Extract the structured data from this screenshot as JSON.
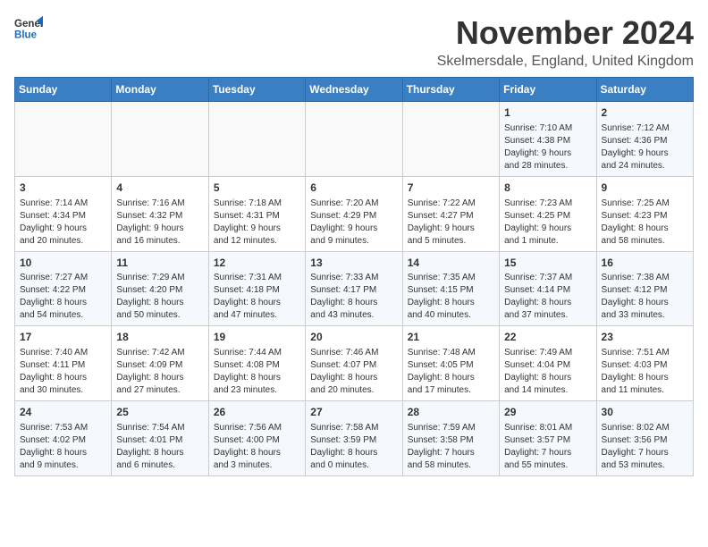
{
  "logo": {
    "line1": "General",
    "line2": "Blue"
  },
  "title": "November 2024",
  "location": "Skelmersdale, England, United Kingdom",
  "days_of_week": [
    "Sunday",
    "Monday",
    "Tuesday",
    "Wednesday",
    "Thursday",
    "Friday",
    "Saturday"
  ],
  "weeks": [
    [
      {
        "day": "",
        "info": ""
      },
      {
        "day": "",
        "info": ""
      },
      {
        "day": "",
        "info": ""
      },
      {
        "day": "",
        "info": ""
      },
      {
        "day": "",
        "info": ""
      },
      {
        "day": "1",
        "info": "Sunrise: 7:10 AM\nSunset: 4:38 PM\nDaylight: 9 hours\nand 28 minutes."
      },
      {
        "day": "2",
        "info": "Sunrise: 7:12 AM\nSunset: 4:36 PM\nDaylight: 9 hours\nand 24 minutes."
      }
    ],
    [
      {
        "day": "3",
        "info": "Sunrise: 7:14 AM\nSunset: 4:34 PM\nDaylight: 9 hours\nand 20 minutes."
      },
      {
        "day": "4",
        "info": "Sunrise: 7:16 AM\nSunset: 4:32 PM\nDaylight: 9 hours\nand 16 minutes."
      },
      {
        "day": "5",
        "info": "Sunrise: 7:18 AM\nSunset: 4:31 PM\nDaylight: 9 hours\nand 12 minutes."
      },
      {
        "day": "6",
        "info": "Sunrise: 7:20 AM\nSunset: 4:29 PM\nDaylight: 9 hours\nand 9 minutes."
      },
      {
        "day": "7",
        "info": "Sunrise: 7:22 AM\nSunset: 4:27 PM\nDaylight: 9 hours\nand 5 minutes."
      },
      {
        "day": "8",
        "info": "Sunrise: 7:23 AM\nSunset: 4:25 PM\nDaylight: 9 hours\nand 1 minute."
      },
      {
        "day": "9",
        "info": "Sunrise: 7:25 AM\nSunset: 4:23 PM\nDaylight: 8 hours\nand 58 minutes."
      }
    ],
    [
      {
        "day": "10",
        "info": "Sunrise: 7:27 AM\nSunset: 4:22 PM\nDaylight: 8 hours\nand 54 minutes."
      },
      {
        "day": "11",
        "info": "Sunrise: 7:29 AM\nSunset: 4:20 PM\nDaylight: 8 hours\nand 50 minutes."
      },
      {
        "day": "12",
        "info": "Sunrise: 7:31 AM\nSunset: 4:18 PM\nDaylight: 8 hours\nand 47 minutes."
      },
      {
        "day": "13",
        "info": "Sunrise: 7:33 AM\nSunset: 4:17 PM\nDaylight: 8 hours\nand 43 minutes."
      },
      {
        "day": "14",
        "info": "Sunrise: 7:35 AM\nSunset: 4:15 PM\nDaylight: 8 hours\nand 40 minutes."
      },
      {
        "day": "15",
        "info": "Sunrise: 7:37 AM\nSunset: 4:14 PM\nDaylight: 8 hours\nand 37 minutes."
      },
      {
        "day": "16",
        "info": "Sunrise: 7:38 AM\nSunset: 4:12 PM\nDaylight: 8 hours\nand 33 minutes."
      }
    ],
    [
      {
        "day": "17",
        "info": "Sunrise: 7:40 AM\nSunset: 4:11 PM\nDaylight: 8 hours\nand 30 minutes."
      },
      {
        "day": "18",
        "info": "Sunrise: 7:42 AM\nSunset: 4:09 PM\nDaylight: 8 hours\nand 27 minutes."
      },
      {
        "day": "19",
        "info": "Sunrise: 7:44 AM\nSunset: 4:08 PM\nDaylight: 8 hours\nand 23 minutes."
      },
      {
        "day": "20",
        "info": "Sunrise: 7:46 AM\nSunset: 4:07 PM\nDaylight: 8 hours\nand 20 minutes."
      },
      {
        "day": "21",
        "info": "Sunrise: 7:48 AM\nSunset: 4:05 PM\nDaylight: 8 hours\nand 17 minutes."
      },
      {
        "day": "22",
        "info": "Sunrise: 7:49 AM\nSunset: 4:04 PM\nDaylight: 8 hours\nand 14 minutes."
      },
      {
        "day": "23",
        "info": "Sunrise: 7:51 AM\nSunset: 4:03 PM\nDaylight: 8 hours\nand 11 minutes."
      }
    ],
    [
      {
        "day": "24",
        "info": "Sunrise: 7:53 AM\nSunset: 4:02 PM\nDaylight: 8 hours\nand 9 minutes."
      },
      {
        "day": "25",
        "info": "Sunrise: 7:54 AM\nSunset: 4:01 PM\nDaylight: 8 hours\nand 6 minutes."
      },
      {
        "day": "26",
        "info": "Sunrise: 7:56 AM\nSunset: 4:00 PM\nDaylight: 8 hours\nand 3 minutes."
      },
      {
        "day": "27",
        "info": "Sunrise: 7:58 AM\nSunset: 3:59 PM\nDaylight: 8 hours\nand 0 minutes."
      },
      {
        "day": "28",
        "info": "Sunrise: 7:59 AM\nSunset: 3:58 PM\nDaylight: 7 hours\nand 58 minutes."
      },
      {
        "day": "29",
        "info": "Sunrise: 8:01 AM\nSunset: 3:57 PM\nDaylight: 7 hours\nand 55 minutes."
      },
      {
        "day": "30",
        "info": "Sunrise: 8:02 AM\nSunset: 3:56 PM\nDaylight: 7 hours\nand 53 minutes."
      }
    ]
  ]
}
